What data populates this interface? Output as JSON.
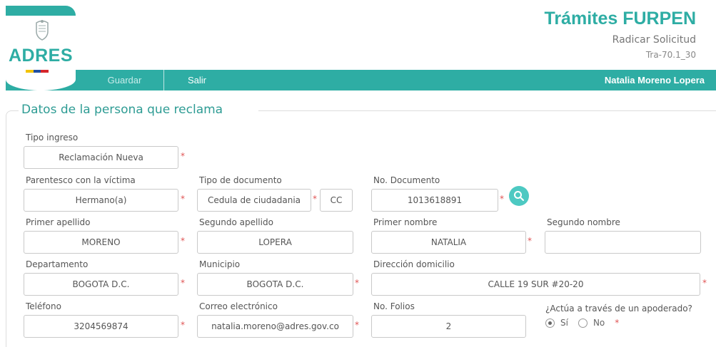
{
  "header": {
    "logo_text": "ADRES",
    "title": "Trámites FURPEN",
    "subtitle": "Radicar Solicitud",
    "code": "Tra-70.1_30"
  },
  "navbar": {
    "guardar": "Guardar",
    "salir": "Salir",
    "user": "Natalia Moreno Lopera"
  },
  "section": {
    "title": "Datos de la persona que reclama"
  },
  "form": {
    "tipo_ingreso": {
      "label": "Tipo ingreso",
      "value": "Reclamación Nueva"
    },
    "parentesco": {
      "label": "Parentesco con la víctima",
      "value": "Hermano(a)"
    },
    "tipo_documento": {
      "label": "Tipo de documento",
      "value": "Cedula de ciudadania",
      "code": "CC"
    },
    "no_documento": {
      "label": "No. Documento",
      "value": "1013618891"
    },
    "primer_apellido": {
      "label": "Primer apellido",
      "value": "MORENO"
    },
    "segundo_apellido": {
      "label": "Segundo apellido",
      "value": "LOPERA"
    },
    "primer_nombre": {
      "label": "Primer nombre",
      "value": "NATALIA"
    },
    "segundo_nombre": {
      "label": "Segundo nombre",
      "value": ""
    },
    "departamento": {
      "label": "Departamento",
      "value": "BOGOTA D.C."
    },
    "municipio": {
      "label": "Municipio",
      "value": "BOGOTA D.C."
    },
    "direccion": {
      "label": "Dirección domicilio",
      "value": "CALLE 19 SUR #20-20"
    },
    "telefono": {
      "label": "Teléfono",
      "value": "3204569874"
    },
    "correo": {
      "label": "Correo electrónico",
      "value": "natalia.moreno@adres.gov.co"
    },
    "folios": {
      "label": "No. Folios",
      "value": "2"
    },
    "apoderado": {
      "label": "¿Actúa a través de un apoderado?",
      "options": [
        "Sí",
        "No"
      ],
      "selected": "Sí"
    }
  },
  "required_mark": "*",
  "colors": {
    "accent": "#2eada4",
    "required": "#e05454"
  }
}
